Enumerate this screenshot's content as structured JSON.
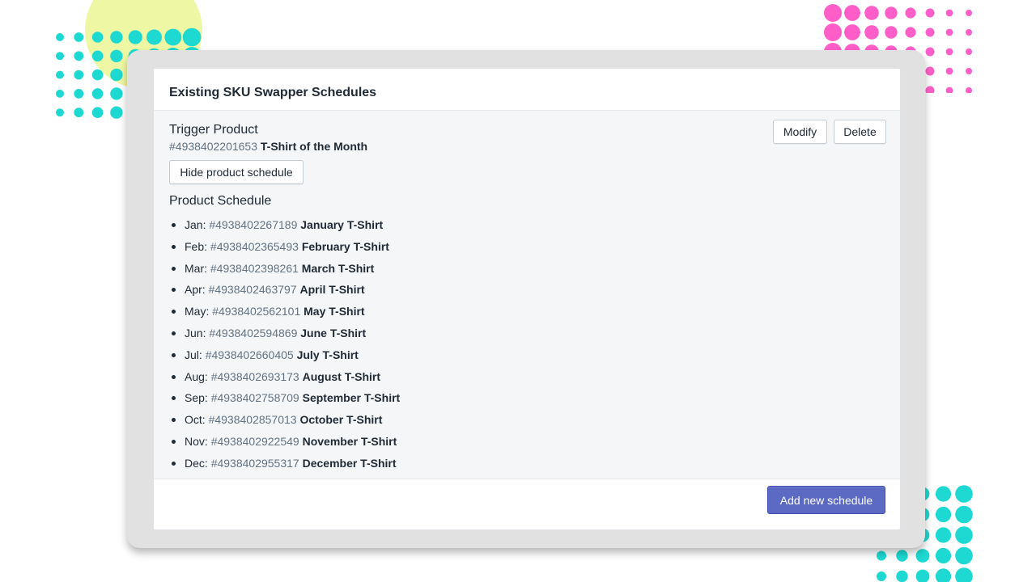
{
  "card": {
    "title": "Existing SKU Swapper Schedules"
  },
  "trigger": {
    "heading": "Trigger Product",
    "sku": "#4938402201653",
    "name": "T-Shirt of the Month"
  },
  "actions": {
    "modify": "Modify",
    "delete": "Delete",
    "hide": "Hide product schedule",
    "add": "Add new schedule"
  },
  "schedule": {
    "heading": "Product Schedule",
    "items": [
      {
        "month": "Jan:",
        "sku": "#4938402267189",
        "name": "January T-Shirt"
      },
      {
        "month": "Feb:",
        "sku": "#4938402365493",
        "name": "February T-Shirt"
      },
      {
        "month": "Mar:",
        "sku": "#4938402398261",
        "name": "March T-Shirt"
      },
      {
        "month": "Apr:",
        "sku": "#4938402463797",
        "name": "April T-Shirt"
      },
      {
        "month": "May:",
        "sku": "#4938402562101",
        "name": "May T-Shirt"
      },
      {
        "month": "Jun:",
        "sku": "#4938402594869",
        "name": "June T-Shirt"
      },
      {
        "month": "Jul:",
        "sku": "#4938402660405",
        "name": "July T-Shirt"
      },
      {
        "month": "Aug:",
        "sku": "#4938402693173",
        "name": "August T-Shirt"
      },
      {
        "month": "Sep:",
        "sku": "#4938402758709",
        "name": "September T-Shirt"
      },
      {
        "month": "Oct:",
        "sku": "#4938402857013",
        "name": "October T-Shirt"
      },
      {
        "month": "Nov:",
        "sku": "#4938402922549",
        "name": "November T-Shirt"
      },
      {
        "month": "Dec:",
        "sku": "#4938402955317",
        "name": "December T-Shirt"
      }
    ]
  },
  "colors": {
    "primary": "#5c6ac4",
    "cyan_dots": "#1dd9d1",
    "pink_dots": "#ff5ec8",
    "yellow_blob": "#eef7a3"
  }
}
